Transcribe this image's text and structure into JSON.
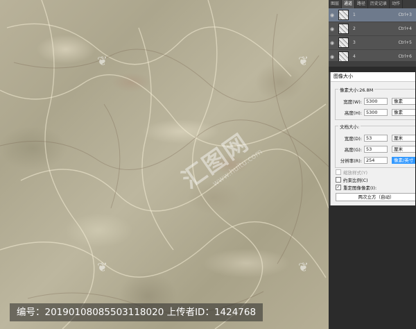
{
  "canvas": {
    "watermarks": {
      "icon": "leaf-logo-icon",
      "center_text": "汇图网",
      "center_url": "www.huitu.com"
    },
    "caption": "编号：20190108085503118020 上传者ID：1424768"
  },
  "layers_panel": {
    "tabs": [
      "图层",
      "通道",
      "路径",
      "历史记录",
      "动作"
    ],
    "active_tab": 1,
    "rows": [
      {
        "name": "1",
        "shortcut": "Ctrl+3",
        "selected": true
      },
      {
        "name": "2",
        "shortcut": "Ctrl+4",
        "selected": false
      },
      {
        "name": "3",
        "shortcut": "Ctrl+5",
        "selected": false
      },
      {
        "name": "4",
        "shortcut": "Ctrl+6",
        "selected": false
      }
    ]
  },
  "dialog": {
    "title": "图像大小",
    "pixel_group": {
      "title": "像素大小:26.8M",
      "width_label": "宽度(W):",
      "width_value": "5300",
      "width_unit": "像素",
      "height_label": "高度(H):",
      "height_value": "5300",
      "height_unit": "像素"
    },
    "doc_group": {
      "title": "文档大小:",
      "width_label": "宽度(D):",
      "width_value": "53",
      "width_unit": "厘米",
      "height_label": "高度(G):",
      "height_value": "53",
      "height_unit": "厘米",
      "res_label": "分辨率(R):",
      "res_value": "254",
      "res_unit": "像素/英寸"
    },
    "checkboxes": {
      "scale_styles": "缩放样式(Y)",
      "constrain": "约束比例(C)",
      "resample": "重定图像像素(I):"
    },
    "resample_method": "两次立方（自动）"
  }
}
